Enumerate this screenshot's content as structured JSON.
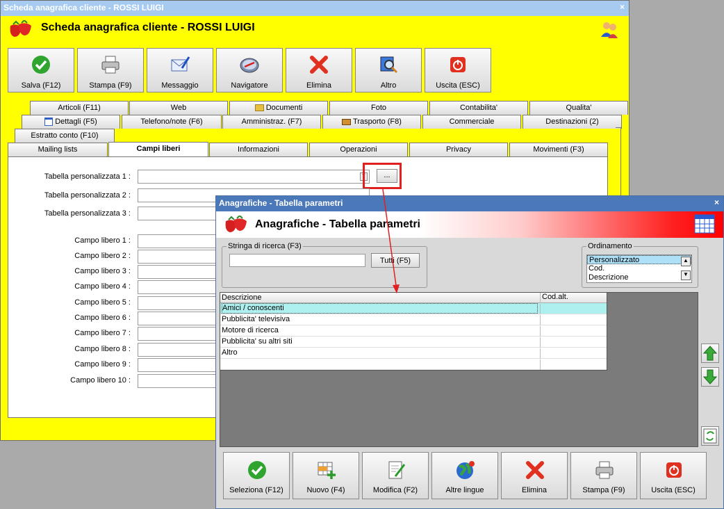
{
  "main": {
    "title": "Scheda anagrafica cliente - ROSSI LUIGI",
    "header": "Scheda anagrafica cliente - ROSSI LUIGI",
    "close": "×",
    "toolbar": [
      "Salva (F12)",
      "Stampa (F9)",
      "Messaggio",
      "Navigatore",
      "Elimina",
      "Altro",
      "Uscita (ESC)"
    ],
    "tabs_row1": [
      "Articoli (F11)",
      "Web",
      "Documenti",
      "Foto",
      "Contabilita'",
      "Qualita'"
    ],
    "tabs_row2": [
      "Dettagli (F5)",
      "Telefono/note (F6)",
      "Amministraz. (F7)",
      "Trasporto (F8)",
      "Commerciale",
      "Destinazioni (2)"
    ],
    "tabs_row3": [
      "Estratto conto (F10)"
    ],
    "tabs_row4": [
      "Mailing lists",
      "Campi liberi",
      "Informazioni",
      "Operazioni",
      "Privacy",
      "Movimenti (F3)"
    ],
    "tables": [
      "Tabella personalizzata 1 :",
      "Tabella personalizzata 2 :",
      "Tabella personalizzata 3 :"
    ],
    "campi": [
      "Campo libero 1 :",
      "Campo libero 2 :",
      "Campo libero 3 :",
      "Campo libero 4 :",
      "Campo libero 5 :",
      "Campo libero 6 :",
      "Campo libero 7 :",
      "Campo libero 8 :",
      "Campo libero 9 :",
      "Campo libero 10 :"
    ],
    "ellipsis": "..."
  },
  "dialog": {
    "title": "Anagrafiche - Tabella parametri",
    "header": "Anagrafiche - Tabella parametri",
    "close": "×",
    "search_legend": "Stringa di ricerca (F3)",
    "search_value": "",
    "tutti": "Tutti (F5)",
    "order_legend": "Ordinamento",
    "order_options": [
      "Personalizzato",
      "Cod.",
      "Descrizione"
    ],
    "columns": [
      "Descrizione",
      "Cod.alt."
    ],
    "rows": [
      [
        "Amici / conoscenti",
        ""
      ],
      [
        "Pubblicita' televisiva",
        ""
      ],
      [
        "Motore di ricerca",
        ""
      ],
      [
        "Pubblicita' su altri siti",
        ""
      ],
      [
        "Altro",
        ""
      ],
      [
        "",
        ""
      ]
    ],
    "bottom": [
      "Seleziona (F12)",
      "Nuovo (F4)",
      "Modifica (F2)",
      "Altre lingue",
      "Elimina",
      "Stampa (F9)",
      "Uscita (ESC)"
    ]
  },
  "colors": {
    "yellow": "#ffff00",
    "highlight": "#aef0f0",
    "annotation": "#e02020"
  }
}
